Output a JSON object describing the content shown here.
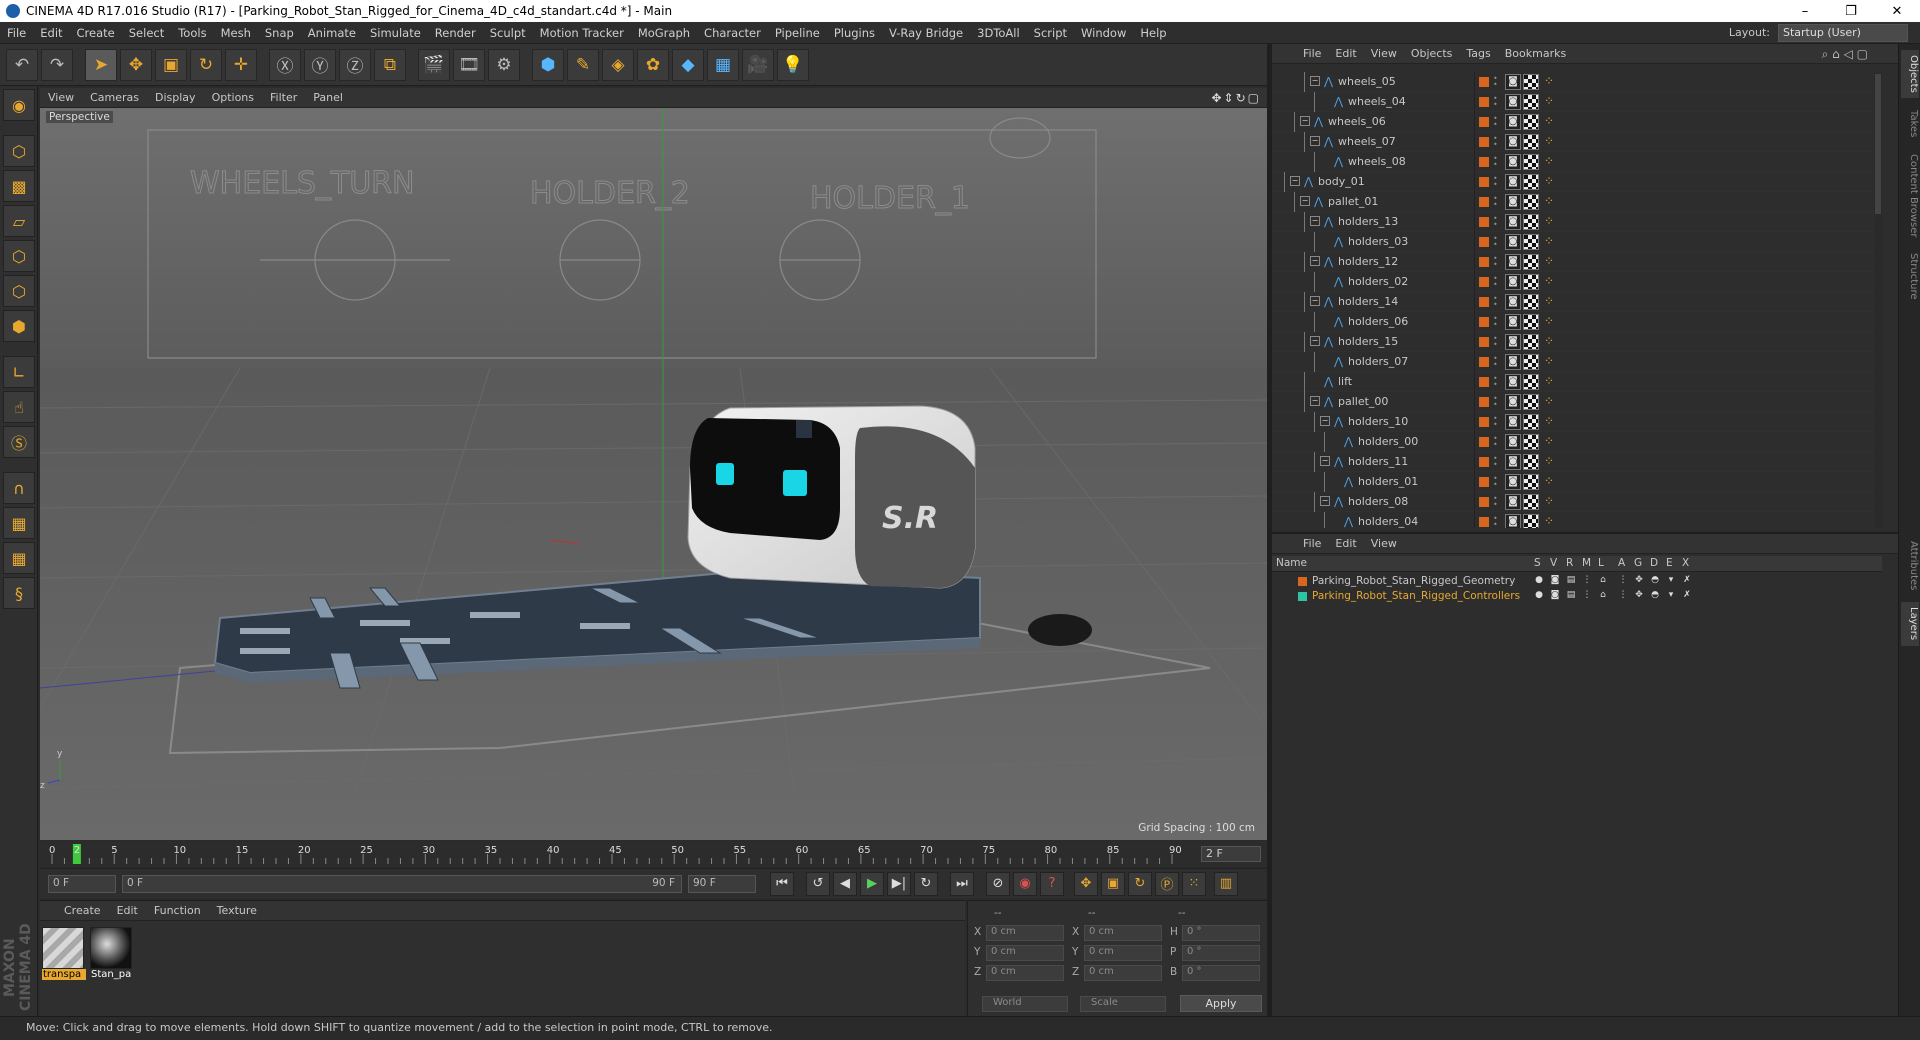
{
  "window": {
    "title": "CINEMA 4D R17.016 Studio (R17) - [Parking_Robot_Stan_Rigged_for_Cinema_4D_c4d_standart.c4d *] - Main",
    "minimize": "–",
    "maximize": "❐",
    "close": "✕"
  },
  "menu": [
    "File",
    "Edit",
    "Create",
    "Select",
    "Tools",
    "Mesh",
    "Snap",
    "Animate",
    "Simulate",
    "Render",
    "Sculpt",
    "Motion Tracker",
    "MoGraph",
    "Character",
    "Pipeline",
    "Plugins",
    "V-Ray Bridge",
    "3DToAll",
    "Script",
    "Window",
    "Help"
  ],
  "layout": {
    "label": "Layout:",
    "value": "Startup (User)"
  },
  "viewport": {
    "menu": [
      "View",
      "Cameras",
      "Display",
      "Options",
      "Filter",
      "Panel"
    ],
    "camera": "Perspective",
    "grid_spacing": "Grid Spacing : 100 cm",
    "robot_logo": "S.R",
    "bg_labels": [
      "WHEELS_TURN",
      "HOLDER_2",
      "HOLDER_1"
    ],
    "axis_y": "y",
    "axis_z": "z"
  },
  "timeline": {
    "ticks": [
      "0",
      "2",
      "5",
      "10",
      "15",
      "20",
      "25",
      "30",
      "35",
      "40",
      "45",
      "50",
      "55",
      "60",
      "65",
      "70",
      "75",
      "80",
      "85",
      "90"
    ],
    "current_frame": "2 F"
  },
  "playback": {
    "start": "0 F",
    "range_start": "0 F",
    "range_end": "90 F",
    "end": "90 F"
  },
  "material_manager": {
    "menu": [
      "Create",
      "Edit",
      "Function",
      "Texture"
    ],
    "materials": [
      {
        "name": "transpa"
      },
      {
        "name": "Stan_pa"
      }
    ]
  },
  "coords": {
    "headers": [
      "--",
      "--",
      "--"
    ],
    "rows": [
      {
        "a": "X",
        "av": "0 cm",
        "b": "X",
        "bv": "0 cm",
        "c": "H",
        "cv": "0 °"
      },
      {
        "a": "Y",
        "av": "0 cm",
        "b": "Y",
        "bv": "0 cm",
        "c": "P",
        "cv": "0 °"
      },
      {
        "a": "Z",
        "av": "0 cm",
        "b": "Z",
        "bv": "0 cm",
        "c": "B",
        "cv": "0 °"
      }
    ],
    "mode": "World",
    "scale": "Scale",
    "apply": "Apply"
  },
  "objects": {
    "menu": [
      "File",
      "Edit",
      "View",
      "Objects",
      "Tags",
      "Bookmarks"
    ],
    "rows": [
      {
        "name": "wheels_05",
        "depth": 4,
        "exp": true
      },
      {
        "name": "wheels_04",
        "depth": 5,
        "exp": false
      },
      {
        "name": "wheels_06",
        "depth": 3,
        "exp": true
      },
      {
        "name": "wheels_07",
        "depth": 4,
        "exp": true
      },
      {
        "name": "wheels_08",
        "depth": 5,
        "exp": false
      },
      {
        "name": "body_01",
        "depth": 2,
        "exp": true
      },
      {
        "name": "pallet_01",
        "depth": 3,
        "exp": true
      },
      {
        "name": "holders_13",
        "depth": 4,
        "exp": true
      },
      {
        "name": "holders_03",
        "depth": 5,
        "exp": false
      },
      {
        "name": "holders_12",
        "depth": 4,
        "exp": true
      },
      {
        "name": "holders_02",
        "depth": 5,
        "exp": false
      },
      {
        "name": "holders_14",
        "depth": 4,
        "exp": true
      },
      {
        "name": "holders_06",
        "depth": 5,
        "exp": false
      },
      {
        "name": "holders_15",
        "depth": 4,
        "exp": true
      },
      {
        "name": "holders_07",
        "depth": 5,
        "exp": false
      },
      {
        "name": "lift",
        "depth": 4,
        "exp": false
      },
      {
        "name": "pallet_00",
        "depth": 4,
        "exp": true
      },
      {
        "name": "holders_10",
        "depth": 5,
        "exp": true
      },
      {
        "name": "holders_00",
        "depth": 6,
        "exp": false
      },
      {
        "name": "holders_11",
        "depth": 5,
        "exp": true
      },
      {
        "name": "holders_01",
        "depth": 6,
        "exp": false
      },
      {
        "name": "holders_08",
        "depth": 5,
        "exp": true
      },
      {
        "name": "holders_04",
        "depth": 6,
        "exp": false
      }
    ]
  },
  "layers": {
    "menu": [
      "File",
      "Edit",
      "View"
    ],
    "headers": [
      "Name",
      "S",
      "V",
      "R",
      "M",
      "L",
      "A",
      "G",
      "D",
      "E",
      "X"
    ],
    "rows": [
      {
        "name": "Parking_Robot_Stan_Rigged_Geometry",
        "color": "#d9661e",
        "text_color": "#c8c8c8"
      },
      {
        "name": "Parking_Robot_Stan_Rigged_Controllers",
        "color": "#2ec4a0",
        "text_color": "#e8a830"
      }
    ]
  },
  "side_tabs": [
    "Objects",
    "Takes",
    "Content Browser",
    "Structure",
    "Attributes",
    "Layers"
  ],
  "status": "Move: Click and drag to move elements. Hold down SHIFT to quantize movement / add to the selection in point mode, CTRL to remove.",
  "maxon": "MAXON CINEMA 4D"
}
